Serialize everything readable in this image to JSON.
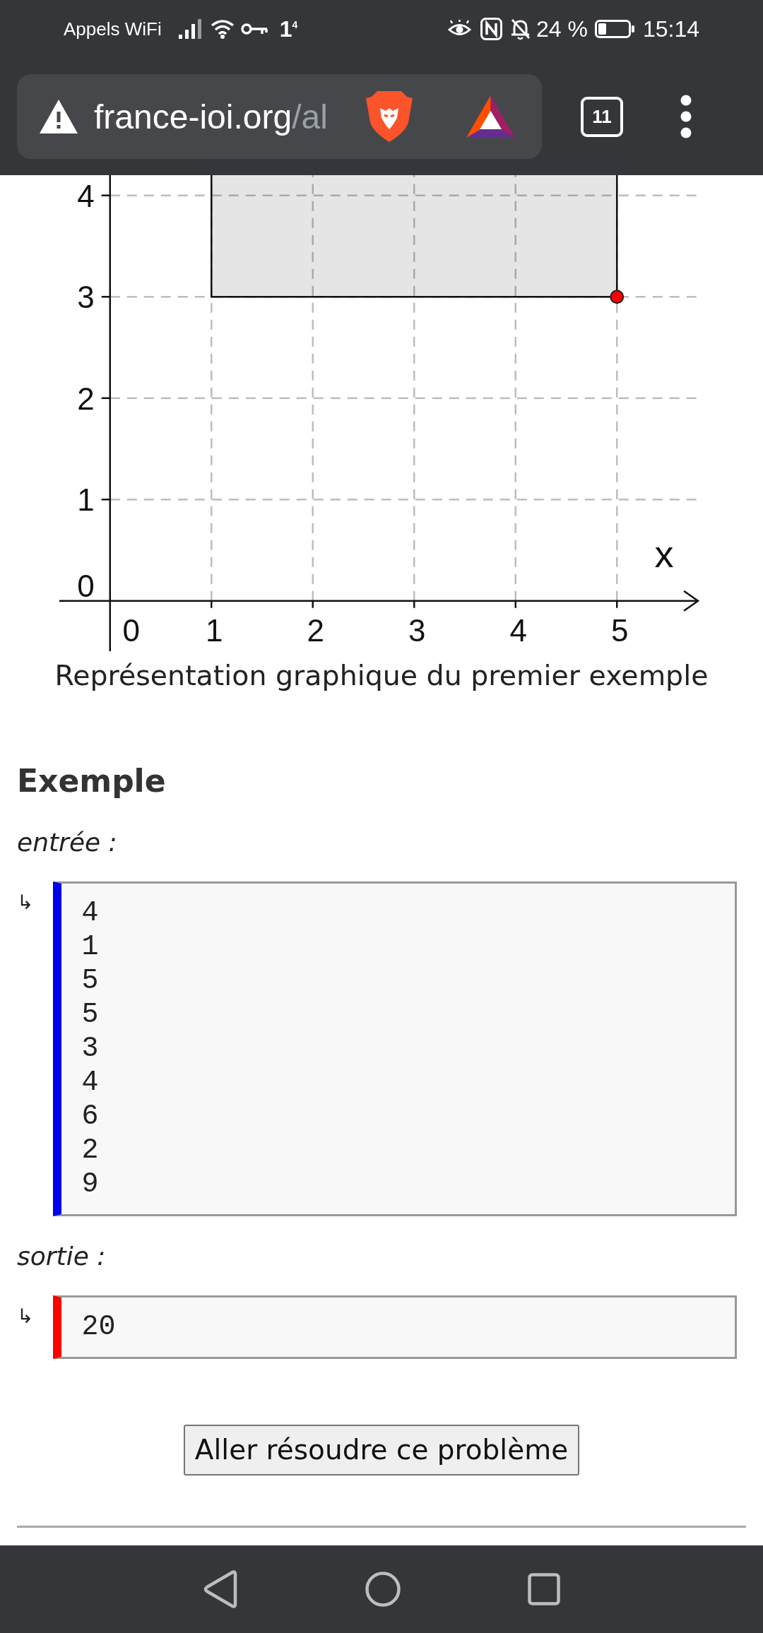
{
  "status_bar": {
    "carrier": "Appels WiFi",
    "network": "1$^{4}$",
    "battery": "24 %",
    "time": "15:14"
  },
  "address_bar": {
    "url_host": "france-ioi.org",
    "url_path": "/al",
    "tab_count": "11"
  },
  "figure": {
    "chart_data": {
      "type": "scatter",
      "xlabel": "x",
      "x": [
        5
      ],
      "series": [
        {
          "color": "#ff0000",
          "values": [
            3
          ]
        }
      ],
      "xlim": [
        -0.5,
        5.8
      ],
      "ylim": [
        -0.5,
        4.2
      ],
      "xticks": [
        0,
        1,
        2,
        3,
        4,
        5
      ],
      "yticks": [
        0,
        1,
        2,
        3,
        4
      ],
      "grid": true,
      "bands": [
        {
          "axis": "x",
          "from": 1,
          "to": 5
        }
      ]
    },
    "caption": "Représentation graphique du premier exemple"
  },
  "example": {
    "title": "Exemple",
    "samples": [
      {
        "label": "entrée :",
        "marker": "↳",
        "color": "#0000ee",
        "lines": [
          "4",
          "1",
          "5",
          "5",
          "3",
          "4",
          "6",
          "2",
          "9"
        ]
      },
      {
        "label": "sortie :",
        "marker": "↳",
        "color": "#ff0000",
        "lines": [
          "20"
        ]
      }
    ]
  },
  "solve_button": {
    "label": "Aller résoudre ce problème"
  }
}
